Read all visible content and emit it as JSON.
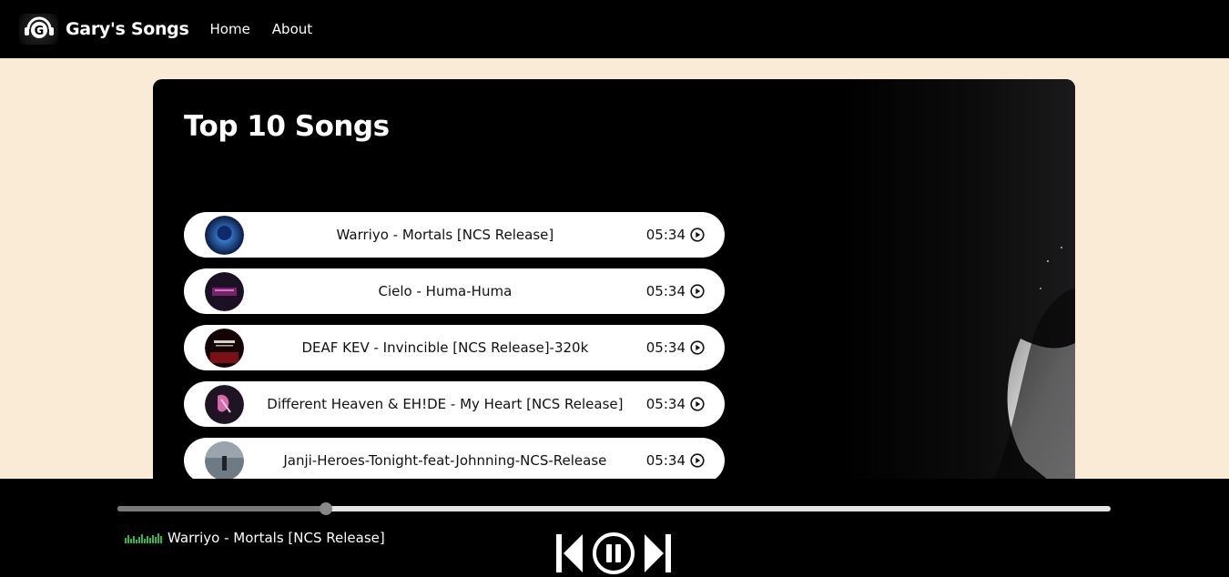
{
  "navbar": {
    "brand": "Gary's Songs",
    "links": [
      "Home",
      "About"
    ]
  },
  "main": {
    "title": "Top 10 Songs",
    "songs": [
      {
        "name": "Warriyo - Mortals [NCS Release]",
        "duration": "05:34",
        "cover_color": "#1b3f8f"
      },
      {
        "name": "Cielo - Huma-Huma",
        "duration": "05:34",
        "cover_color": "#2a1530"
      },
      {
        "name": "DEAF KEV - Invincible [NCS Release]-320k",
        "duration": "05:34",
        "cover_color": "#5a0d12"
      },
      {
        "name": "Different Heaven & EH!DE - My Heart [NCS Release]",
        "duration": "05:34",
        "cover_color": "#3a2440"
      },
      {
        "name": "Janji-Heroes-Tonight-feat-Johnning-NCS-Release",
        "duration": "05:34",
        "cover_color": "#4a5560"
      }
    ]
  },
  "player": {
    "now_playing": "Warriyo - Mortals [NCS Release]",
    "progress": 0.21,
    "controls": [
      "skip-back-icon",
      "pause-icon",
      "skip-forward-icon"
    ]
  },
  "colors": {
    "page_bg": "#faebd7",
    "bar_bg": "#000000",
    "eq_green": "#2fb64a"
  }
}
